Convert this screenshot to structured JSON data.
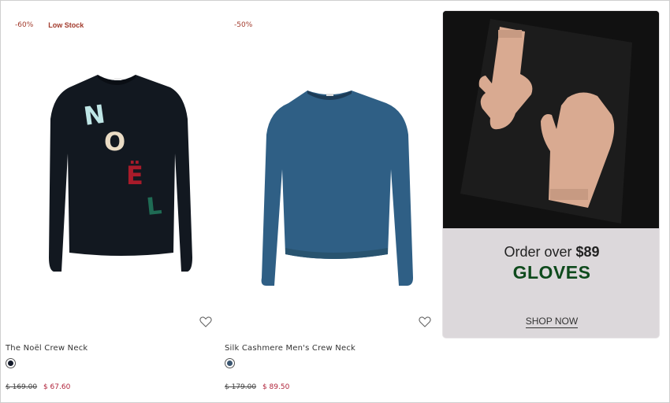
{
  "products": [
    {
      "discount_badge": "-60%",
      "stock_badge": "Low Stock",
      "name": "The Noël Crew Neck",
      "old_price": "$ 169.00",
      "new_price": "$ 67.60",
      "swatch_color": "#131a2a",
      "sweater_letters": [
        "N",
        "O",
        "Ë",
        "L"
      ]
    },
    {
      "discount_badge": "-50%",
      "name": "Silk Cashmere Men's Crew Neck",
      "old_price": "$ 179.00",
      "new_price": "$ 89.50",
      "swatch_color": "#3a5570"
    }
  ],
  "promo": {
    "line1_prefix": "Order over",
    "line1_amount": "$89",
    "line2": "GLOVES",
    "cta": "SHOP NOW"
  },
  "colors": {
    "badge": "#a23a2c",
    "sale_price": "#b0233a",
    "promo_bg": "#dcd8db",
    "promo_heading": "#0e4a1c"
  }
}
